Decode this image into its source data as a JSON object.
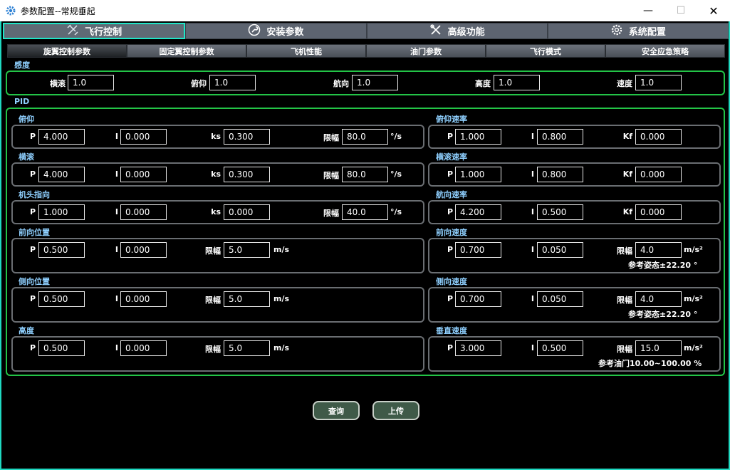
{
  "window": {
    "title": "参数配置--常规垂起",
    "min_icon": "minimize-icon",
    "max_icon": "maximize-icon",
    "close_icon": "close-icon"
  },
  "colors": {
    "accent": "#20e6c8",
    "group_border": "#23c447",
    "label": "#8fd0ff"
  },
  "main_tabs": [
    {
      "label": "飞行控制",
      "icon": "drone-icon",
      "active": true
    },
    {
      "label": "安装参数",
      "icon": "wrench-icon",
      "active": false
    },
    {
      "label": "高级功能",
      "icon": "tools-icon",
      "active": false
    },
    {
      "label": "系统配置",
      "icon": "gear-icon",
      "active": false
    }
  ],
  "sub_tabs": [
    {
      "label": "旋翼控制参数",
      "active": true
    },
    {
      "label": "固定翼控制参数",
      "active": false
    },
    {
      "label": "飞机性能",
      "active": false
    },
    {
      "label": "油门参数",
      "active": false
    },
    {
      "label": "飞行模式",
      "active": false
    },
    {
      "label": "安全应急策略",
      "active": false
    }
  ],
  "sensitivity": {
    "title": "感度",
    "fields": [
      {
        "label": "横滚",
        "value": "1.0"
      },
      {
        "label": "俯仰",
        "value": "1.0"
      },
      {
        "label": "航向",
        "value": "1.0"
      },
      {
        "label": "高度",
        "value": "1.0"
      },
      {
        "label": "速度",
        "value": "1.0"
      }
    ]
  },
  "pid": {
    "title": "PID",
    "labels": {
      "p": "P",
      "i": "I",
      "ks": "ks",
      "kf": "Kf",
      "limit": "限幅"
    },
    "left": [
      {
        "title": "俯仰",
        "p": "4.000",
        "i": "0.000",
        "ks": "0.300",
        "limit": "80.0",
        "unit": "°/s"
      },
      {
        "title": "横滚",
        "p": "4.000",
        "i": "0.000",
        "ks": "0.300",
        "limit": "80.0",
        "unit": "°/s"
      },
      {
        "title": "机头指向",
        "p": "1.000",
        "i": "0.000",
        "ks": "0.000",
        "limit": "40.0",
        "unit": "°/s"
      },
      {
        "title": "前向位置",
        "p": "0.500",
        "i": "0.000",
        "limit": "5.0",
        "unit": "m/s"
      },
      {
        "title": "侧向位置",
        "p": "0.500",
        "i": "0.000",
        "limit": "5.0",
        "unit": "m/s"
      },
      {
        "title": "高度",
        "p": "0.500",
        "i": "0.000",
        "limit": "5.0",
        "unit": "m/s"
      }
    ],
    "right": [
      {
        "title": "俯仰速率",
        "p": "1.000",
        "i": "0.800",
        "kf": "0.000"
      },
      {
        "title": "横滚速率",
        "p": "1.000",
        "i": "0.800",
        "kf": "0.000"
      },
      {
        "title": "航向速率",
        "p": "4.200",
        "i": "0.500",
        "kf": "0.000"
      },
      {
        "title": "前向速度",
        "p": "0.700",
        "i": "0.050",
        "limit": "4.0",
        "unit": "m/s²",
        "note": "参考姿态±22.20 °"
      },
      {
        "title": "侧向速度",
        "p": "0.700",
        "i": "0.050",
        "limit": "4.0",
        "unit": "m/s²",
        "note": "参考姿态±22.20 °"
      },
      {
        "title": "垂直速度",
        "p": "3.000",
        "i": "0.500",
        "limit": "15.0",
        "unit": "m/s²",
        "note": "参考油门10.00~100.00 %"
      }
    ]
  },
  "buttons": {
    "query": "查询",
    "upload": "上传"
  }
}
